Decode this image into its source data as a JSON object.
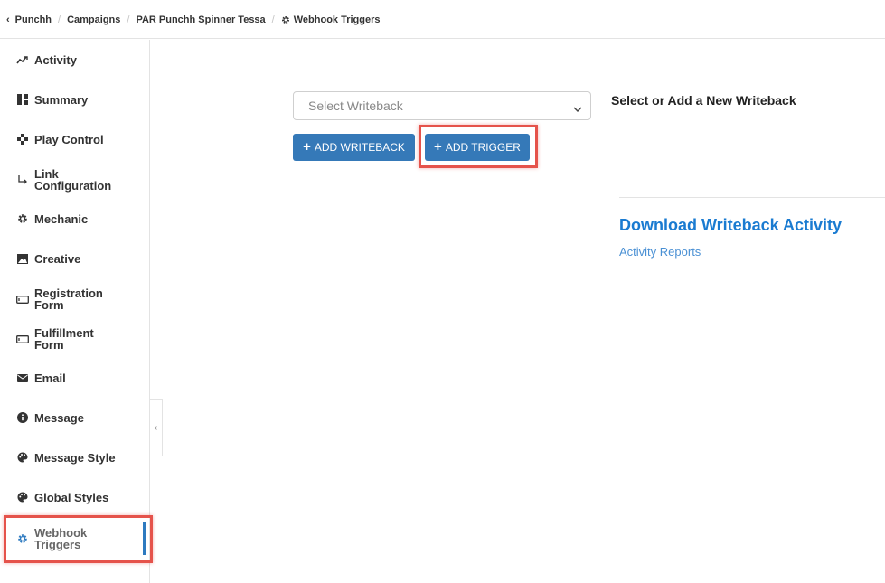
{
  "breadcrumb": {
    "items": [
      "Punchh",
      "Campaigns",
      "PAR Punchh Spinner Tessa",
      "Webhook Triggers"
    ]
  },
  "sidebar": {
    "items": [
      {
        "label": "Activity",
        "icon": "activity-icon"
      },
      {
        "label": "Summary",
        "icon": "summary-icon"
      },
      {
        "label": "Play Control",
        "icon": "play-control-icon"
      },
      {
        "label": "Link Configuration",
        "icon": "link-arrow-icon"
      },
      {
        "label": "Mechanic",
        "icon": "gear-icon"
      },
      {
        "label": "Creative",
        "icon": "image-icon"
      },
      {
        "label": "Registration Form",
        "icon": "form-icon"
      },
      {
        "label": "Fulfillment Form",
        "icon": "form-icon"
      },
      {
        "label": "Email",
        "icon": "envelope-icon"
      },
      {
        "label": "Message",
        "icon": "info-icon"
      },
      {
        "label": "Message Style",
        "icon": "palette-icon"
      },
      {
        "label": "Global Styles",
        "icon": "palette-icon"
      },
      {
        "label": "Webhook Triggers",
        "icon": "gear-icon",
        "active": true
      }
    ]
  },
  "main": {
    "select_placeholder": "Select Writeback",
    "add_writeback_label": "ADD WRITEBACK",
    "add_trigger_label": "ADD TRIGGER",
    "right_title": "Select or Add a New Writeback",
    "download_title": "Download Writeback Activity",
    "activity_reports_link": "Activity Reports"
  },
  "colors": {
    "primary_button": "#3579b8",
    "link": "#1a7bd1",
    "highlight": "#e5534b",
    "active_indicator": "#2d7ac0"
  }
}
